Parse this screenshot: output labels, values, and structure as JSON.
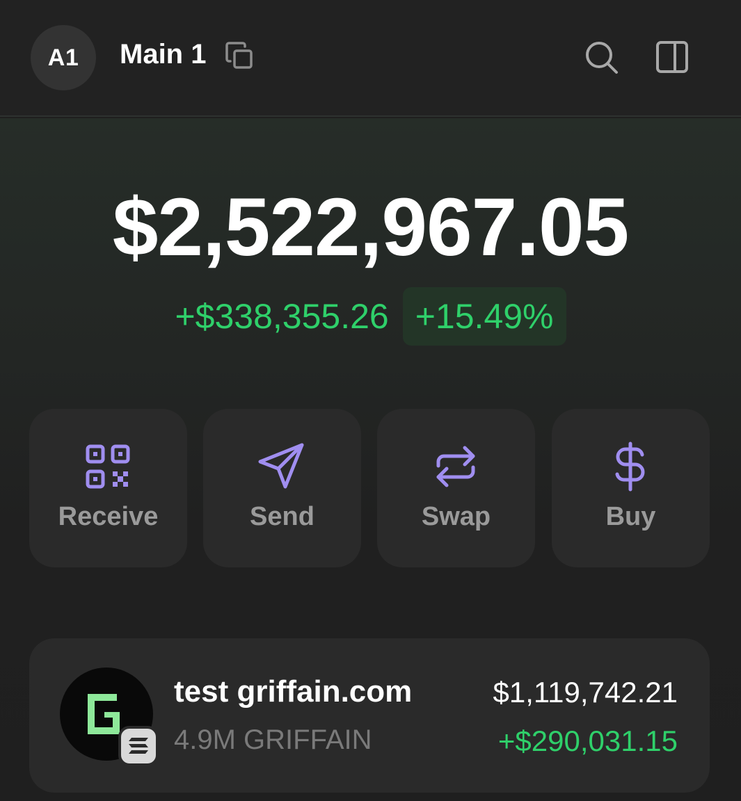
{
  "header": {
    "avatar_initials": "A1",
    "account_name": "Main 1",
    "icons": [
      "copy-icon",
      "search-icon",
      "sidebar-panel-icon"
    ]
  },
  "portfolio": {
    "balance": "$2,522,967.05",
    "change_amount": "+$338,355.26",
    "change_percent": "+15.49%",
    "positive_color": "#2fd06a"
  },
  "actions": [
    {
      "label": "Receive",
      "icon": "qr-code-icon"
    },
    {
      "label": "Send",
      "icon": "send-icon"
    },
    {
      "label": "Swap",
      "icon": "swap-icon"
    },
    {
      "label": "Buy",
      "icon": "dollar-icon"
    }
  ],
  "accent_color": "#a08ef0",
  "tokens": [
    {
      "name": "test griffain.com",
      "quantity": "4.9M GRIFFAIN",
      "value": "$1,119,742.21",
      "change": "+$290,031.15",
      "logo_icon": "griffain-logo-icon",
      "chain_icon": "solana-badge-icon"
    }
  ]
}
